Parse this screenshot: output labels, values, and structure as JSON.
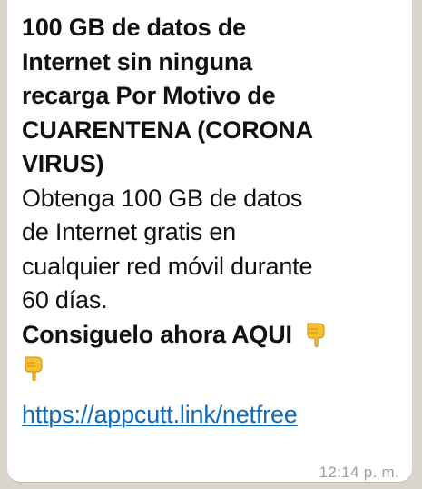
{
  "message": {
    "headline_lines": [
      "100 GB de datos de",
      "Internet sin ninguna",
      "recarga Por Motivo de",
      "CUARENTENA (CORONA",
      "VIRUS)"
    ],
    "body_lines": [
      "Obtenga 100 GB de datos",
      "de Internet gratis en",
      "cualquier red móvil durante",
      "60 días."
    ],
    "cta": "Consiguelo ahora AQUI",
    "cta_icon": "pointing-down-hand-icon",
    "link": "https://appcutt.link/netfree",
    "timestamp": "12:14 p. m."
  },
  "colors": {
    "chat_background": "#d9d4cc",
    "bubble": "#ffffff",
    "text": "#111111",
    "link": "#0f6ab8",
    "timestamp": "#9aa0a3",
    "emoji": "#f5c12e"
  }
}
